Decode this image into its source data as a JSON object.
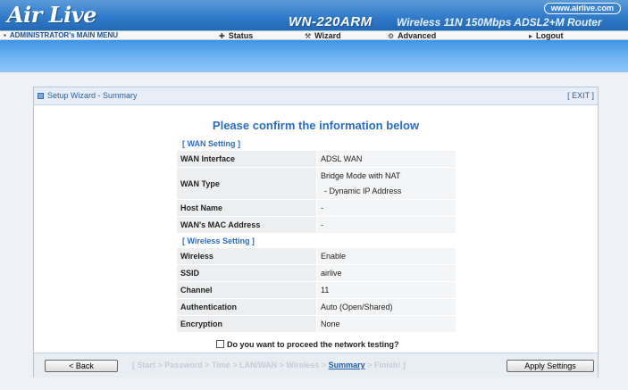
{
  "header": {
    "logo": "Air Live",
    "url": "www.airlive.com",
    "model": "WN-220ARM",
    "subtitle": "Wireless 11N 150Mbps ADSL2+M Router"
  },
  "nav": {
    "menu_title": "ADMINISTRATOR's MAIN MENU",
    "items": [
      {
        "label": "Status",
        "icon": "status-icon"
      },
      {
        "label": "Wizard",
        "icon": "wizard-icon"
      },
      {
        "label": "Advanced",
        "icon": "advanced-icon"
      },
      {
        "label": "Logout",
        "icon": "logout-icon"
      }
    ]
  },
  "panel": {
    "title": "Setup Wizard - Summary",
    "exit": "[ EXIT ]",
    "confirm_title": "Please confirm the information below"
  },
  "wan": {
    "section": "[ WAN Setting ]",
    "interface_label": "WAN Interface",
    "interface_value": "ADSL WAN",
    "type_label": "WAN Type",
    "type_value_line1": "Bridge Mode with NAT",
    "type_value_line2": "- Dynamic IP Address",
    "host_label": "Host Name",
    "host_value": "-",
    "mac_label": "WAN's MAC Address",
    "mac_value": "-"
  },
  "wireless": {
    "section": "[ Wireless Setting ]",
    "wireless_label": "Wireless",
    "wireless_value": "Enable",
    "ssid_label": "SSID",
    "ssid_value": "airlive",
    "channel_label": "Channel",
    "channel_value": "11",
    "auth_label": "Authentication",
    "auth_value": "Auto (Open/Shared)",
    "enc_label": "Encryption",
    "enc_value": "None"
  },
  "proceed": {
    "label": "Do you want to proceed the network testing?"
  },
  "footer": {
    "back_label": "< Back",
    "apply_label": "Apply Settings",
    "steps_before": "[ Start > Password > Time > LAN/WAN > Wireless > ",
    "steps_current": "Summary",
    "steps_after": " > Finish! ]"
  },
  "colors": {
    "header_blue": "#2f79c9",
    "accent_blue": "#2a6dbf",
    "band_blue": "#6db2f2"
  }
}
